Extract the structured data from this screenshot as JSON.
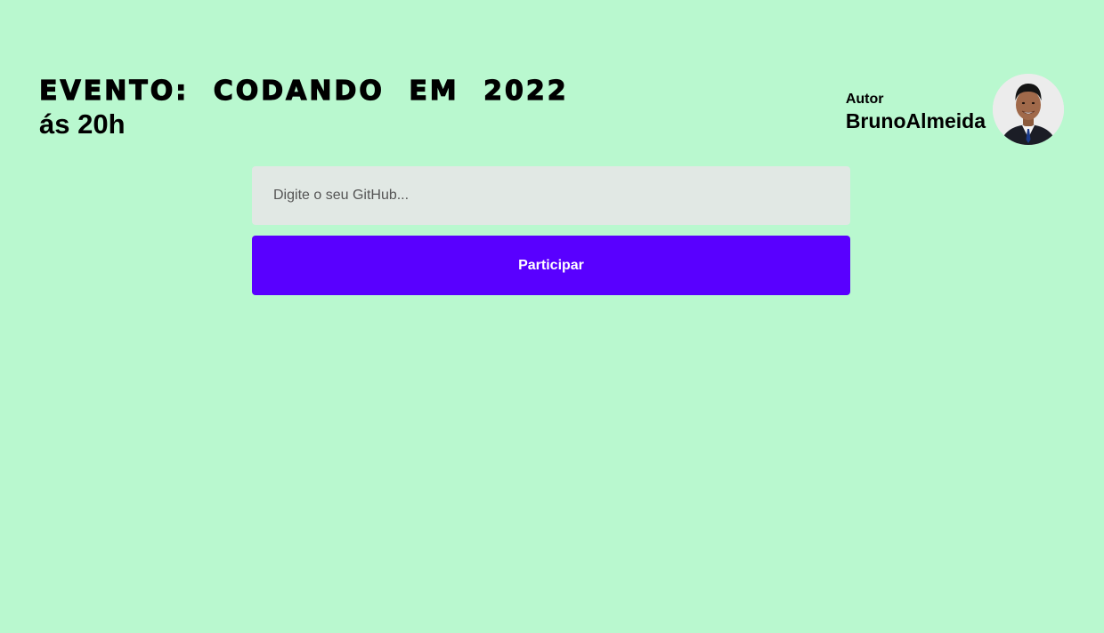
{
  "header": {
    "title": "EVENTO: CODANDO EM 2022",
    "subtitle": "ás 20h"
  },
  "author": {
    "label": "Autor",
    "name": "BrunoAlmeida",
    "avatar_icon": "person-photo-icon"
  },
  "form": {
    "github_placeholder": "Digite o seu GitHub...",
    "github_value": "",
    "submit_label": "Participar"
  },
  "colors": {
    "background": "#b9f8cf",
    "accent": "#5900ff",
    "input_background": "#e1e8e4"
  }
}
